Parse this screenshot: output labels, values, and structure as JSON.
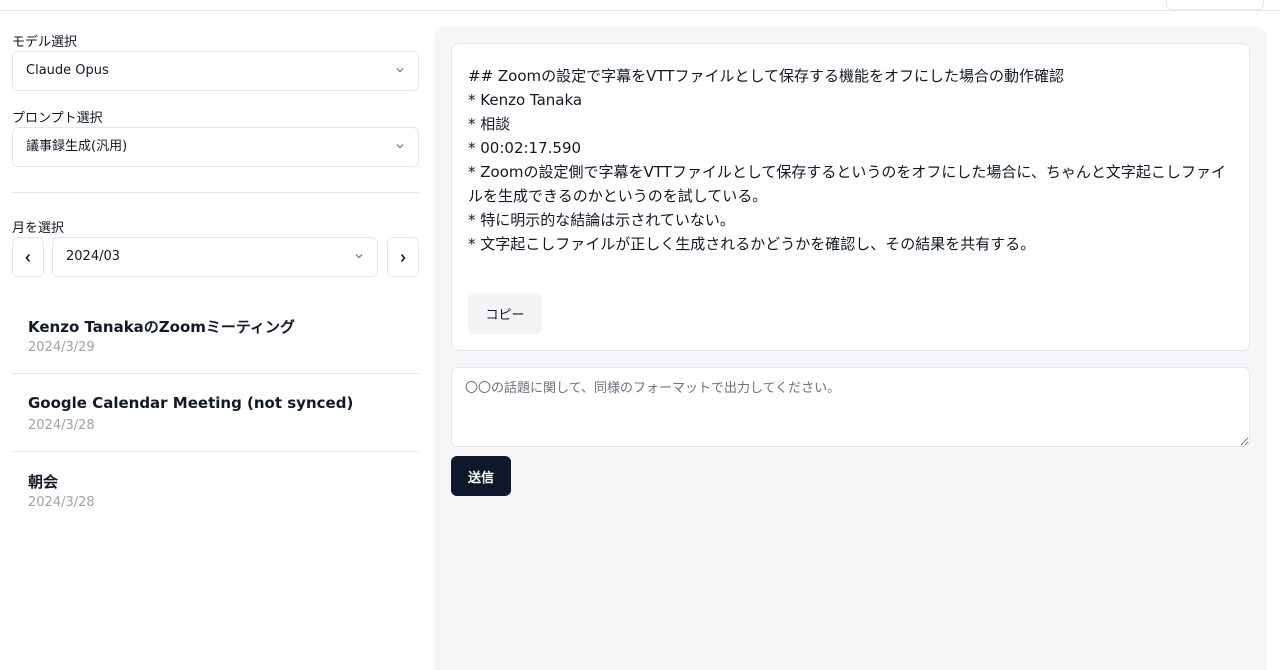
{
  "sidebar": {
    "model": {
      "label": "モデル選択",
      "value": "Claude Opus"
    },
    "prompt": {
      "label": "プロンプト選択",
      "value": "議事録生成(汎用)"
    },
    "month": {
      "label": "月を選択",
      "value": "2024/03",
      "prev_label": "‹",
      "next_label": "›"
    },
    "meetings": [
      {
        "title": "Kenzo TanakaのZoomミーティング",
        "date": "2024/3/29"
      },
      {
        "title": "Google Calendar Meeting (not synced)",
        "date": "2024/3/28"
      },
      {
        "title": "朝会",
        "date": "2024/3/28"
      }
    ]
  },
  "main": {
    "output_lines": [
      "## Zoomの設定で字幕をVTTファイルとして保存する機能をオフにした場合の動作確認",
      "* Kenzo Tanaka",
      "* 相談",
      "* 00:02:17.590",
      "* Zoomの設定側で字幕をVTTファイルとして保存するというのをオフにした場合に、ちゃんと文字起こしファイルを生成できるのかというのを試している。",
      "* 特に明示的な結論は示されていない。",
      "* 文字起こしファイルが正しく生成されるかどうかを確認し、その結果を共有する。"
    ],
    "copy_label": "コピー",
    "input": {
      "placeholder": "〇〇の話題に関して、同様のフォーマットで出力してください。",
      "value": ""
    },
    "send_label": "送信"
  },
  "colors": {
    "send_button": "#0f172a",
    "panel_bg": "#f5f6f8",
    "border": "#e5e7eb",
    "muted_text": "#9ca3af"
  },
  "icons": {
    "dropdown": "chevron-down-icon",
    "prev": "chevron-left-icon",
    "next": "chevron-right-icon"
  }
}
